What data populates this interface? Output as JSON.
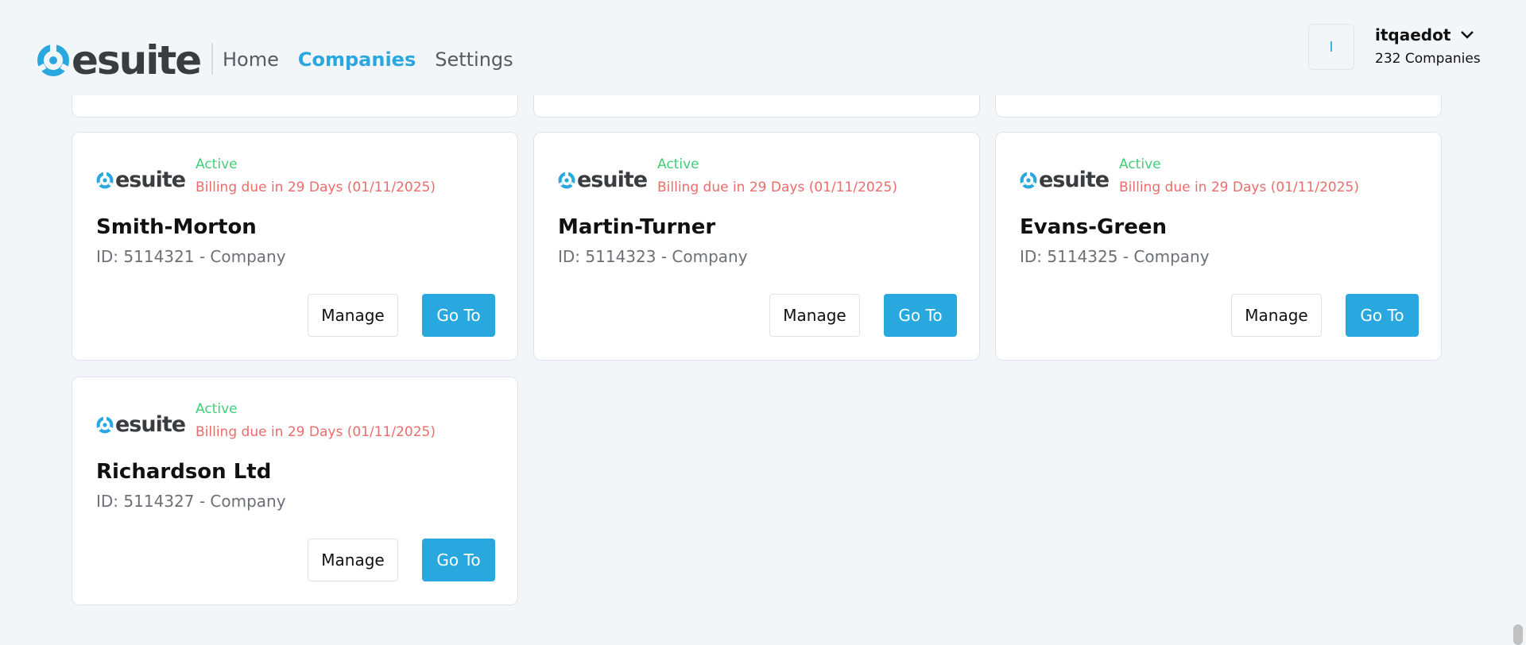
{
  "brand": {
    "name": "esuite",
    "accent": "#29a8df",
    "dark": "#3b3c40"
  },
  "nav": [
    {
      "label": "Home",
      "active": false
    },
    {
      "label": "Companies",
      "active": true
    },
    {
      "label": "Settings",
      "active": false
    }
  ],
  "user": {
    "avatar_initial": "I",
    "name": "itqaedot",
    "count": "232 Companies"
  },
  "colors": {
    "status_active": "#3fcf77",
    "billing_due": "#ee6b6b",
    "background": "#f3f6f9"
  },
  "cards": [
    {
      "status": "Active",
      "billing": "Billing due in 29 Days (01/11/2025)",
      "name": "Smith-Morton",
      "id_line": "ID: 5114321 - Company",
      "manage_label": "Manage",
      "goto_label": "Go To"
    },
    {
      "status": "Active",
      "billing": "Billing due in 29 Days (01/11/2025)",
      "name": "Martin-Turner",
      "id_line": "ID: 5114323 - Company",
      "manage_label": "Manage",
      "goto_label": "Go To"
    },
    {
      "status": "Active",
      "billing": "Billing due in 29 Days (01/11/2025)",
      "name": "Evans-Green",
      "id_line": "ID: 5114325 - Company",
      "manage_label": "Manage",
      "goto_label": "Go To"
    },
    {
      "status": "Active",
      "billing": "Billing due in 29 Days (01/11/2025)",
      "name": "Richardson Ltd",
      "id_line": "ID: 5114327 - Company",
      "manage_label": "Manage",
      "goto_label": "Go To"
    }
  ]
}
